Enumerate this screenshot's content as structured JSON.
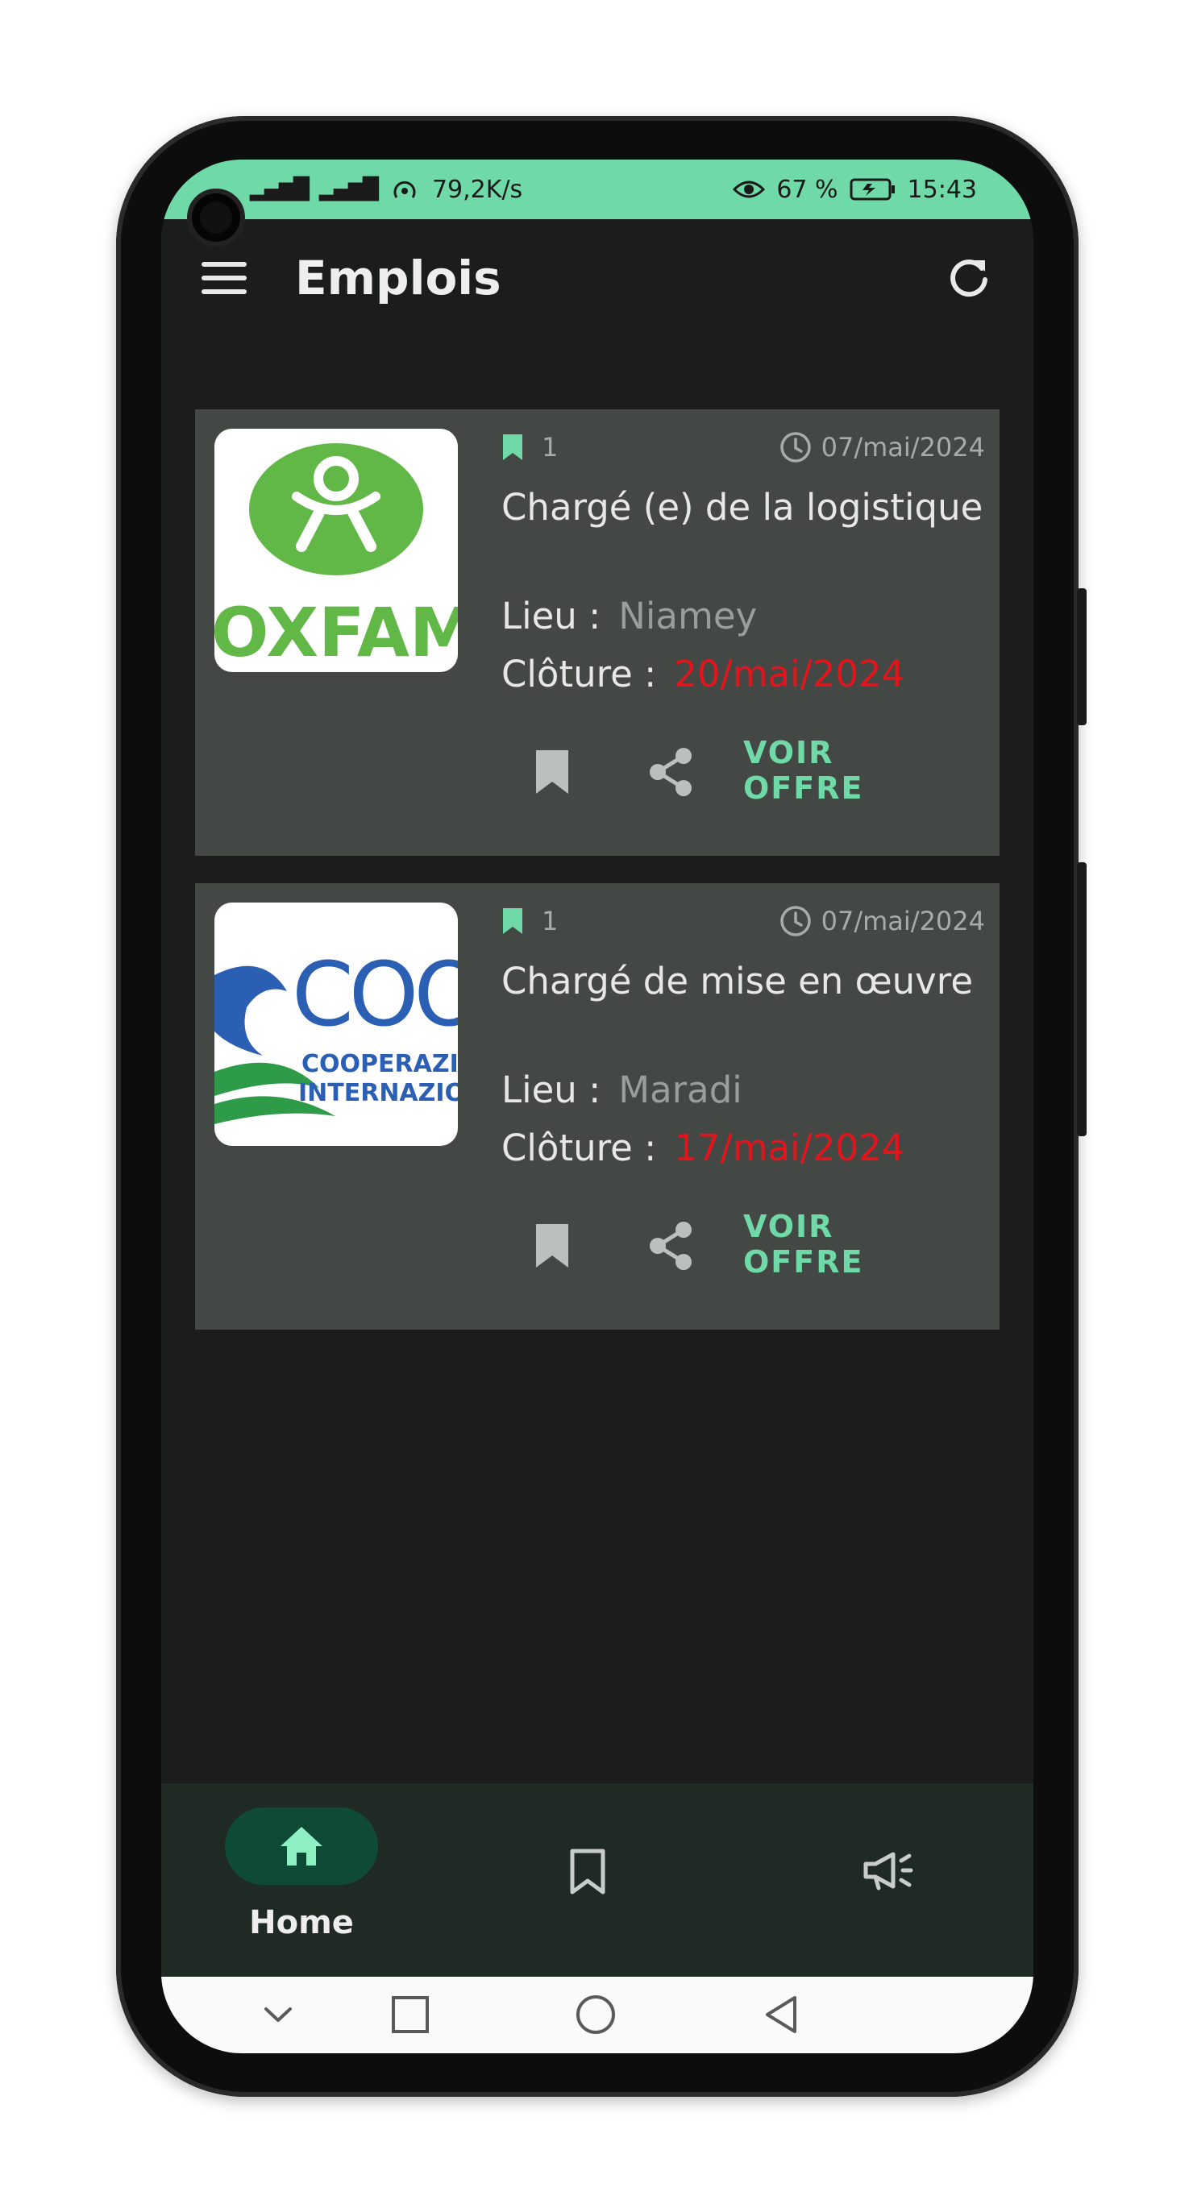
{
  "status_bar": {
    "net_speed": "79,2K/s",
    "battery": "67 %",
    "time": "15:43"
  },
  "app_bar": {
    "title": "Emplois"
  },
  "jobs": [
    {
      "logo_text": "OXFAM",
      "saves": "1",
      "posted": "07/mai/2024",
      "title": "Chargé (e) de la logistique",
      "lieu_label": "Lieu :",
      "lieu": "Niamey",
      "cloture_label": "Clôture :",
      "cloture": "20/mai/2024",
      "cta": "VOIR OFFRE"
    },
    {
      "logo_text": "COOP",
      "logo_sub1": "COOPERAZIONE",
      "logo_sub2": "INTERNAZIONALE",
      "saves": "1",
      "posted": "07/mai/2024",
      "title": "Chargé de mise en œuvre",
      "lieu_label": "Lieu :",
      "lieu": "Maradi",
      "cloture_label": "Clôture :",
      "cloture": "17/mai/2024",
      "cta": "VOIR OFFRE"
    }
  ],
  "bottom_nav": {
    "home_label": "Home"
  },
  "colors": {
    "accent": "#6fd9a7",
    "card_bg": "#444845",
    "screen_bg": "#1b1d1c",
    "deadline": "#e3141b",
    "oxfam_green": "#61b846",
    "coop_blue": "#2b5fb4"
  },
  "icons": {
    "menu": "menu-icon",
    "refresh": "refresh-icon",
    "bookmark": "bookmark-icon",
    "share": "share-icon",
    "clock": "clock-icon",
    "home": "home-icon",
    "announce": "megaphone-icon"
  }
}
